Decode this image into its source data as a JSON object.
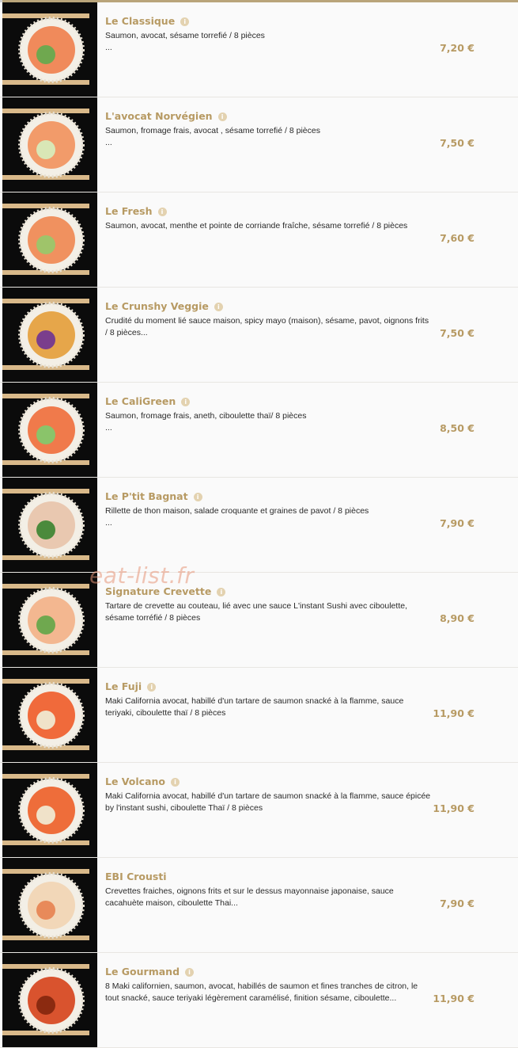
{
  "watermark": "eat-list.fr",
  "colors": {
    "accent": "#b79a63",
    "text": "#2a2a2a",
    "thumb_bg": "#0b0b0b"
  },
  "items": [
    {
      "name": "Le Classique",
      "desc": "Saumon, avocat, sésame torrefié / 8 pièces",
      "desc2": "...",
      "price": "7,20 €",
      "info": true
    },
    {
      "name": "L'avocat Norvégien",
      "desc": "Saumon, fromage frais, avocat , sésame torrefié / 8 pièces",
      "desc2": "...",
      "price": "7,50 €",
      "info": true
    },
    {
      "name": "Le Fresh",
      "desc": "Saumon, avocat, menthe et pointe de corriande fraîche, sésame torrefié / 8 pièces",
      "desc2": "",
      "price": "7,60 €",
      "info": true
    },
    {
      "name": "Le Crunshy Veggie",
      "desc": "Crudité du moment lié sauce maison, spicy mayo (maison), sésame, pavot, oignons frits / 8 pièces...",
      "desc2": "",
      "price": "7,50 €",
      "info": true
    },
    {
      "name": "Le CaliGreen",
      "desc": "Saumon, fromage frais, aneth, ciboulette thaï/ 8 pièces",
      "desc2": "...",
      "price": "8,50 €",
      "info": true
    },
    {
      "name": "Le P'tit Bagnat",
      "desc": "Rillette de thon maison, salade croquante et graines de pavot / 8 pièces",
      "desc2": "...",
      "price": "7,90 €",
      "info": true
    },
    {
      "name": "Signature Crevette",
      "desc": "Tartare de crevette au couteau, lié avec une sauce L'instant Sushi avec ciboulette, sésame torréfié / 8 pièces",
      "desc2": "",
      "price": "8,90 €",
      "info": true
    },
    {
      "name": "Le Fuji",
      "desc": "Maki California avocat, habillé d'un tartare de saumon snacké à la flamme, sauce teriyaki, ciboulette thaï / 8 pièces",
      "desc2": "",
      "price": "11,90 €",
      "info": true
    },
    {
      "name": "Le Volcano",
      "desc": "Maki California avocat, habillé d'un tartare de saumon snacké à la flamme, sauce épicée by l'instant sushi, ciboulette Thaï / 8 pièces",
      "desc2": "",
      "price": "11,90 €",
      "info": true
    },
    {
      "name": "EBI Crousti",
      "desc": "Crevettes fraiches, oignons frits et sur le dessus mayonnaise japonaise, sauce cacahuète maison, ciboulette Thai...",
      "desc2": "",
      "price": "7,90 €",
      "info": false
    },
    {
      "name": "Le Gourmand",
      "desc": "8 Maki californien, saumon, avocat, habillés de saumon et fines tranches de citron, le tout snacké, sauce teriyaki légèrement caramélisé, finition sésame, ciboulette...",
      "desc2": "",
      "price": "11,90 €",
      "info": true
    }
  ]
}
